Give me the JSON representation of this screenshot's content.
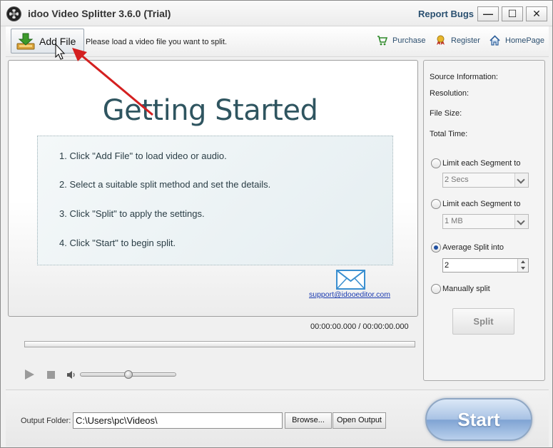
{
  "window": {
    "title": "idoo Video Splitter 3.6.0 (Trial)",
    "report_bugs": "Report Bugs",
    "controls": {
      "minimize": "—",
      "maximize": "☐",
      "close": "✕"
    }
  },
  "toolbar": {
    "add_file": "Add File",
    "hint": "Please load a video file you want to split.",
    "purchase": "Purchase",
    "register": "Register",
    "homepage": "HomePage"
  },
  "preview": {
    "heading": "Getting Started",
    "steps": [
      "1. Click \"Add File\" to load video or audio.",
      "2. Select a suitable split method and set the details.",
      "3. Click \"Split\" to apply the settings.",
      "4. Click \"Start\" to begin split."
    ],
    "support_email": "support@idooeditor.com"
  },
  "player": {
    "timecode": "00:00:00.000 / 00:00:00.000",
    "volume_level": 0.5
  },
  "source_info": {
    "source": "Source Information:",
    "resolution": "Resolution:",
    "file_size": "File Size:",
    "total_time": "Total Time:"
  },
  "split_options": {
    "segment_time": {
      "label": "Limit each Segment to",
      "value": "2 Secs",
      "checked": false
    },
    "segment_size": {
      "label": "Limit each Segment to",
      "value": "1 MB",
      "checked": false
    },
    "average": {
      "label": "Average Split into",
      "value": "2",
      "checked": true
    },
    "manual": {
      "label": "Manually split",
      "checked": false
    },
    "split_button": "Split"
  },
  "output": {
    "label": "Output Folder:",
    "path": "C:\\Users\\pc\\Videos\\",
    "browse": "Browse...",
    "open_output": "Open Output",
    "start": "Start"
  },
  "colors": {
    "heading": "#2f5560",
    "link": "#1a3ab0",
    "annotation_arrow": "#d42020",
    "radio_selected": "#1f4fa0"
  }
}
